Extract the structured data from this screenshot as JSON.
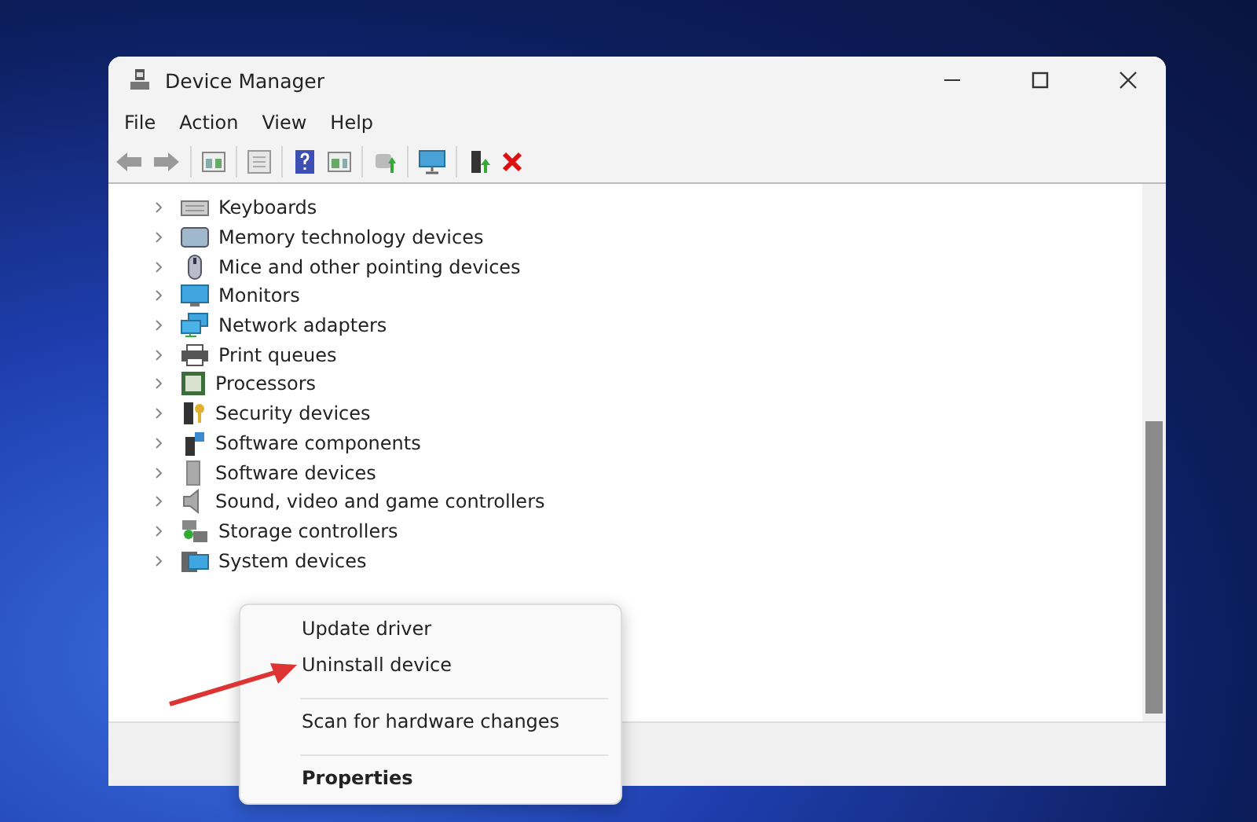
{
  "window": {
    "title": "Device Manager"
  },
  "menu": [
    "File",
    "Action",
    "View",
    "Help"
  ],
  "tree": [
    {
      "label": "Keyboards",
      "kind": "keyboard",
      "expanded": false
    },
    {
      "label": "Memory technology devices",
      "kind": "memory",
      "expanded": false
    },
    {
      "label": "Mice and other pointing devices",
      "kind": "mouse",
      "expanded": false
    },
    {
      "label": "Monitors",
      "kind": "monitor",
      "expanded": false
    },
    {
      "label": "Network adapters",
      "kind": "network",
      "expanded": false
    },
    {
      "label": "Print queues",
      "kind": "printer",
      "expanded": false
    },
    {
      "label": "Processors",
      "kind": "processor",
      "expanded": false
    },
    {
      "label": "Security devices",
      "kind": "security",
      "expanded": false
    },
    {
      "label": "Software components",
      "kind": "component",
      "expanded": false
    },
    {
      "label": "Software devices",
      "kind": "software",
      "expanded": false
    },
    {
      "label": "Sound, video and game controllers",
      "kind": "sound",
      "expanded": false
    },
    {
      "label": "Storage controllers",
      "kind": "storage",
      "expanded": false
    },
    {
      "label": "System devices",
      "kind": "system",
      "expanded": false
    }
  ],
  "context_menu": [
    {
      "label": "Update driver",
      "default": false,
      "separator_before": false
    },
    {
      "label": "Uninstall device",
      "default": false,
      "separator_before": false
    },
    {
      "label": "Scan for hardware changes",
      "default": false,
      "separator_before": true
    },
    {
      "label": "Properties",
      "default": true,
      "separator_before": true
    }
  ]
}
